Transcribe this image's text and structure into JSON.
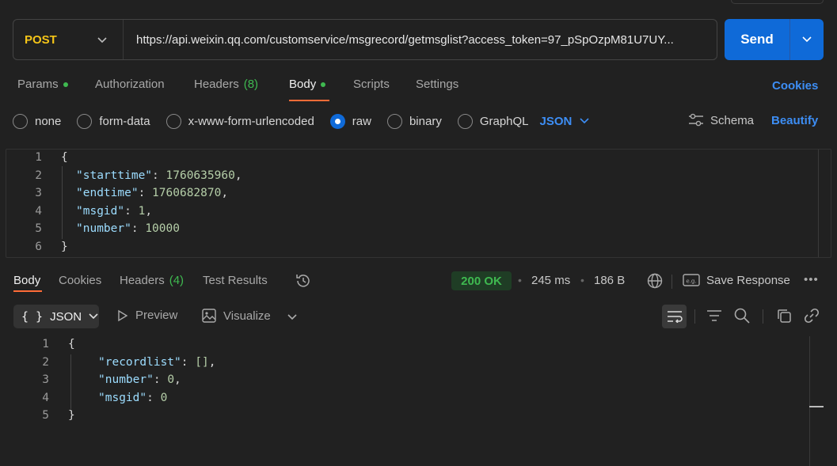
{
  "request": {
    "method": "POST",
    "url": "https://api.weixin.qq.com/customservice/msgrecord/getmsglist?access_token=97_pSpOzpM81U7UY...",
    "send_label": "Send"
  },
  "request_tabs": {
    "params": "Params",
    "authorization": "Authorization",
    "headers": "Headers",
    "headers_count": "(8)",
    "body": "Body",
    "scripts": "Scripts",
    "settings": "Settings",
    "cookies": "Cookies"
  },
  "body_types": {
    "none": "none",
    "form_data": "form-data",
    "urlencoded": "x-www-form-urlencoded",
    "raw": "raw",
    "binary": "binary",
    "graphql": "GraphQL",
    "format": "JSON",
    "schema": "Schema",
    "beautify": "Beautify"
  },
  "request_body": {
    "line_numbers": [
      "1",
      "2",
      "3",
      "4",
      "5",
      "6"
    ],
    "open_brace": "{",
    "close_brace": "}",
    "fields": [
      {
        "key": "\"starttime\"",
        "value": "1760635960",
        "trail": ","
      },
      {
        "key": "\"endtime\"",
        "value": "1760682870",
        "trail": ","
      },
      {
        "key": "\"msgid\"",
        "value": "1",
        "trail": ","
      },
      {
        "key": "\"number\"",
        "value": "10000",
        "trail": ""
      }
    ]
  },
  "response_tabs": {
    "body": "Body",
    "cookies": "Cookies",
    "headers": "Headers",
    "headers_count": "(4)",
    "test_results": "Test Results"
  },
  "response_meta": {
    "status": "200 OK",
    "time": "245 ms",
    "size": "186 B",
    "save_response": "Save Response"
  },
  "response_toolbar": {
    "format": "JSON",
    "preview": "Preview",
    "visualize": "Visualize"
  },
  "response_body": {
    "line_numbers": [
      "1",
      "2",
      "3",
      "4",
      "5"
    ],
    "open_brace": "{",
    "close_brace": "}",
    "fields": [
      {
        "key": "\"recordlist\"",
        "value": "[]",
        "trail": ","
      },
      {
        "key": "\"number\"",
        "value": "0",
        "trail": ","
      },
      {
        "key": "\"msgid\"",
        "value": "0",
        "trail": ""
      }
    ]
  },
  "colors": {
    "accent_blue": "#0f6ad8",
    "method_yellow": "#f5c518",
    "success_green": "#3fb950",
    "active_underline": "#ff6c37"
  }
}
